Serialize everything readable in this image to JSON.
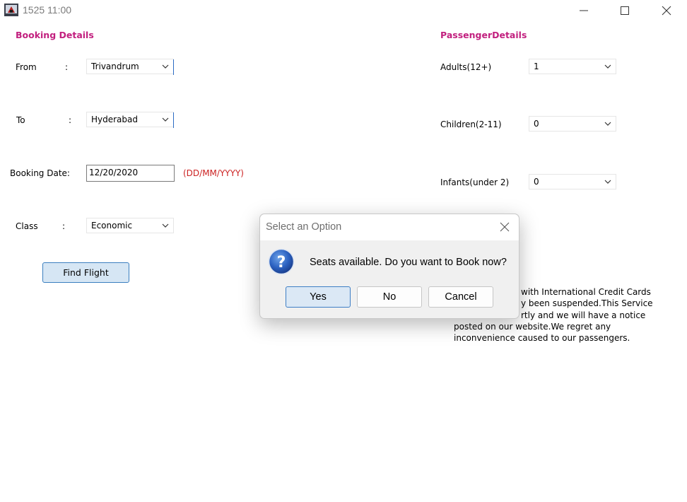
{
  "window": {
    "title": "1525 11:00",
    "controls": {
      "minimize_icon": "minimize-icon",
      "maximize_icon": "maximize-icon",
      "close_icon": "close-icon"
    }
  },
  "booking": {
    "section_title": "Booking Details",
    "from_label": "From",
    "from_colon": ":",
    "from_value": "Trivandrum",
    "to_label": "To",
    "to_colon": ":",
    "to_value": "Hyderabad",
    "date_label": "Booking Date:",
    "date_value": "12/20/2020",
    "date_hint": "(DD/MM/YYYY)",
    "class_label": "Class",
    "class_colon": ":",
    "class_value": "Economic",
    "find_button": "Find Flight"
  },
  "passenger": {
    "section_title": "PassengerDetails",
    "adults_label": "Adults(12+)",
    "adults_value": "1",
    "children_label": "Children(2-11)",
    "children_value": "0",
    "infants_label": "Infants(under 2)",
    "infants_value": "0"
  },
  "notice": {
    "line1": "with International Credit Cards",
    "line2": "y been suspended.This Service",
    "line3": "rtly and we will have a notice",
    "line4": "posted on our website.We regret any",
    "line5": "inconvenience caused to our passengers."
  },
  "dialog": {
    "title": "Select an Option",
    "message": "Seats available. Do you want to Book now?",
    "yes_label": "Yes",
    "no_label": "No",
    "cancel_label": "Cancel",
    "icon": "question-icon"
  },
  "colors": {
    "section_title": "#c2207f",
    "hint": "#cc2222",
    "primary_button_bg": "#d6e6f4",
    "primary_button_border": "#3b7fbf"
  }
}
